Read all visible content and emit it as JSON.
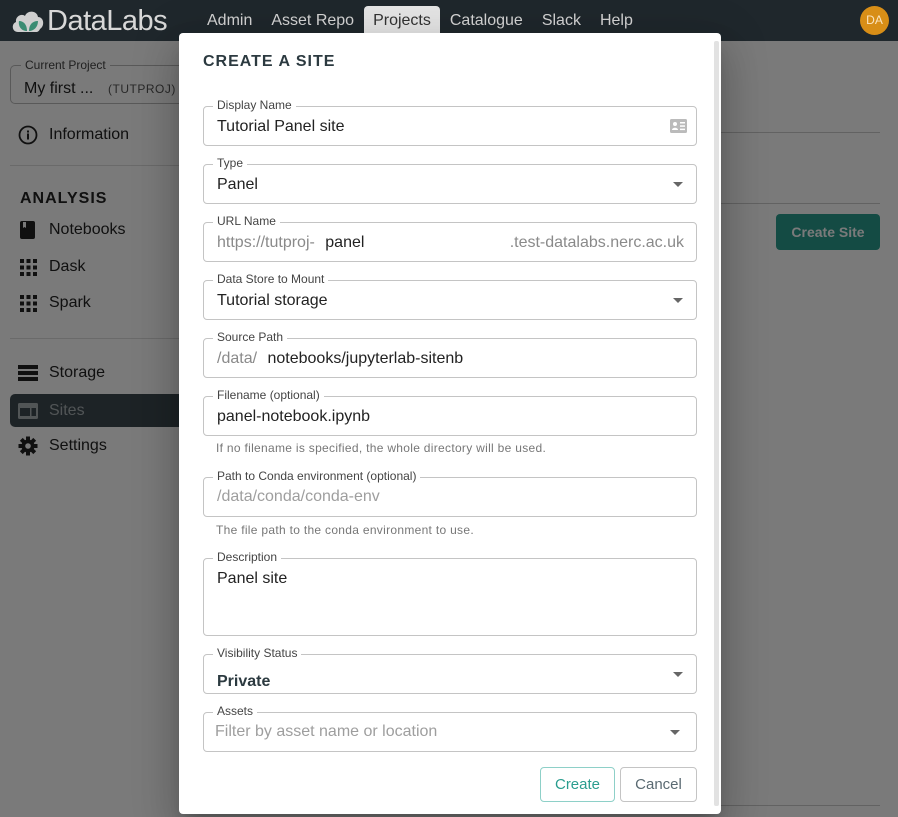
{
  "app": {
    "logo_text": "DataLabs",
    "nav": [
      {
        "label": "Admin",
        "active": false
      },
      {
        "label": "Asset Repo",
        "active": false
      },
      {
        "label": "Projects",
        "active": true
      },
      {
        "label": "Catalogue",
        "active": false
      },
      {
        "label": "Slack",
        "active": false
      },
      {
        "label": "Help",
        "active": false
      }
    ],
    "user_initials": "DA"
  },
  "sidebar": {
    "project_label": "Current Project",
    "project_name": "My first ...",
    "project_key": "(TUTPROJ)",
    "info_item": {
      "label": "Information",
      "icon": "info-icon"
    },
    "section_heading": "ANALYSIS",
    "analysis_items": [
      {
        "label": "Notebooks",
        "icon": "notebook-icon"
      },
      {
        "label": "Dask",
        "icon": "grid-icon"
      },
      {
        "label": "Spark",
        "icon": "grid-icon"
      }
    ],
    "other_items": [
      {
        "label": "Storage",
        "icon": "storage-icon",
        "active": false
      },
      {
        "label": "Sites",
        "icon": "sites-icon",
        "active": true
      },
      {
        "label": "Settings",
        "icon": "gear-icon",
        "active": false
      }
    ]
  },
  "page": {
    "create_site_button": "Create Site"
  },
  "dialog": {
    "title": "CREATE A SITE",
    "fields": {
      "display_name": {
        "label": "Display Name",
        "value": "Tutorial Panel site",
        "icon": "contact-card-icon"
      },
      "type": {
        "label": "Type",
        "value": "Panel"
      },
      "url_name": {
        "label": "URL Name",
        "prefix": "https://tutproj-",
        "value": "panel",
        "suffix": ".test-datalabs.nerc.ac.uk"
      },
      "data_store": {
        "label": "Data Store to Mount",
        "value": "Tutorial storage"
      },
      "source_path": {
        "label": "Source Path",
        "prefix": "/data/",
        "value": "notebooks/jupyterlab-sitenb"
      },
      "filename": {
        "label": "Filename (optional)",
        "value": "panel-notebook.ipynb",
        "helper": "If no filename is specified, the whole directory will be used."
      },
      "conda_path": {
        "label": "Path to Conda environment (optional)",
        "placeholder": "/data/conda/conda-env",
        "helper": "The file path to the conda environment to use."
      },
      "description": {
        "label": "Description",
        "value": "Panel site"
      },
      "visibility": {
        "label": "Visibility Status",
        "value": "Private"
      },
      "assets": {
        "label": "Assets",
        "placeholder": "Filter by asset name or location"
      }
    },
    "buttons": {
      "create": "Create",
      "cancel": "Cancel"
    }
  },
  "colors": {
    "accent": "#2a9d8f",
    "topbar": "#1f272c",
    "avatar": "#d88e17"
  }
}
